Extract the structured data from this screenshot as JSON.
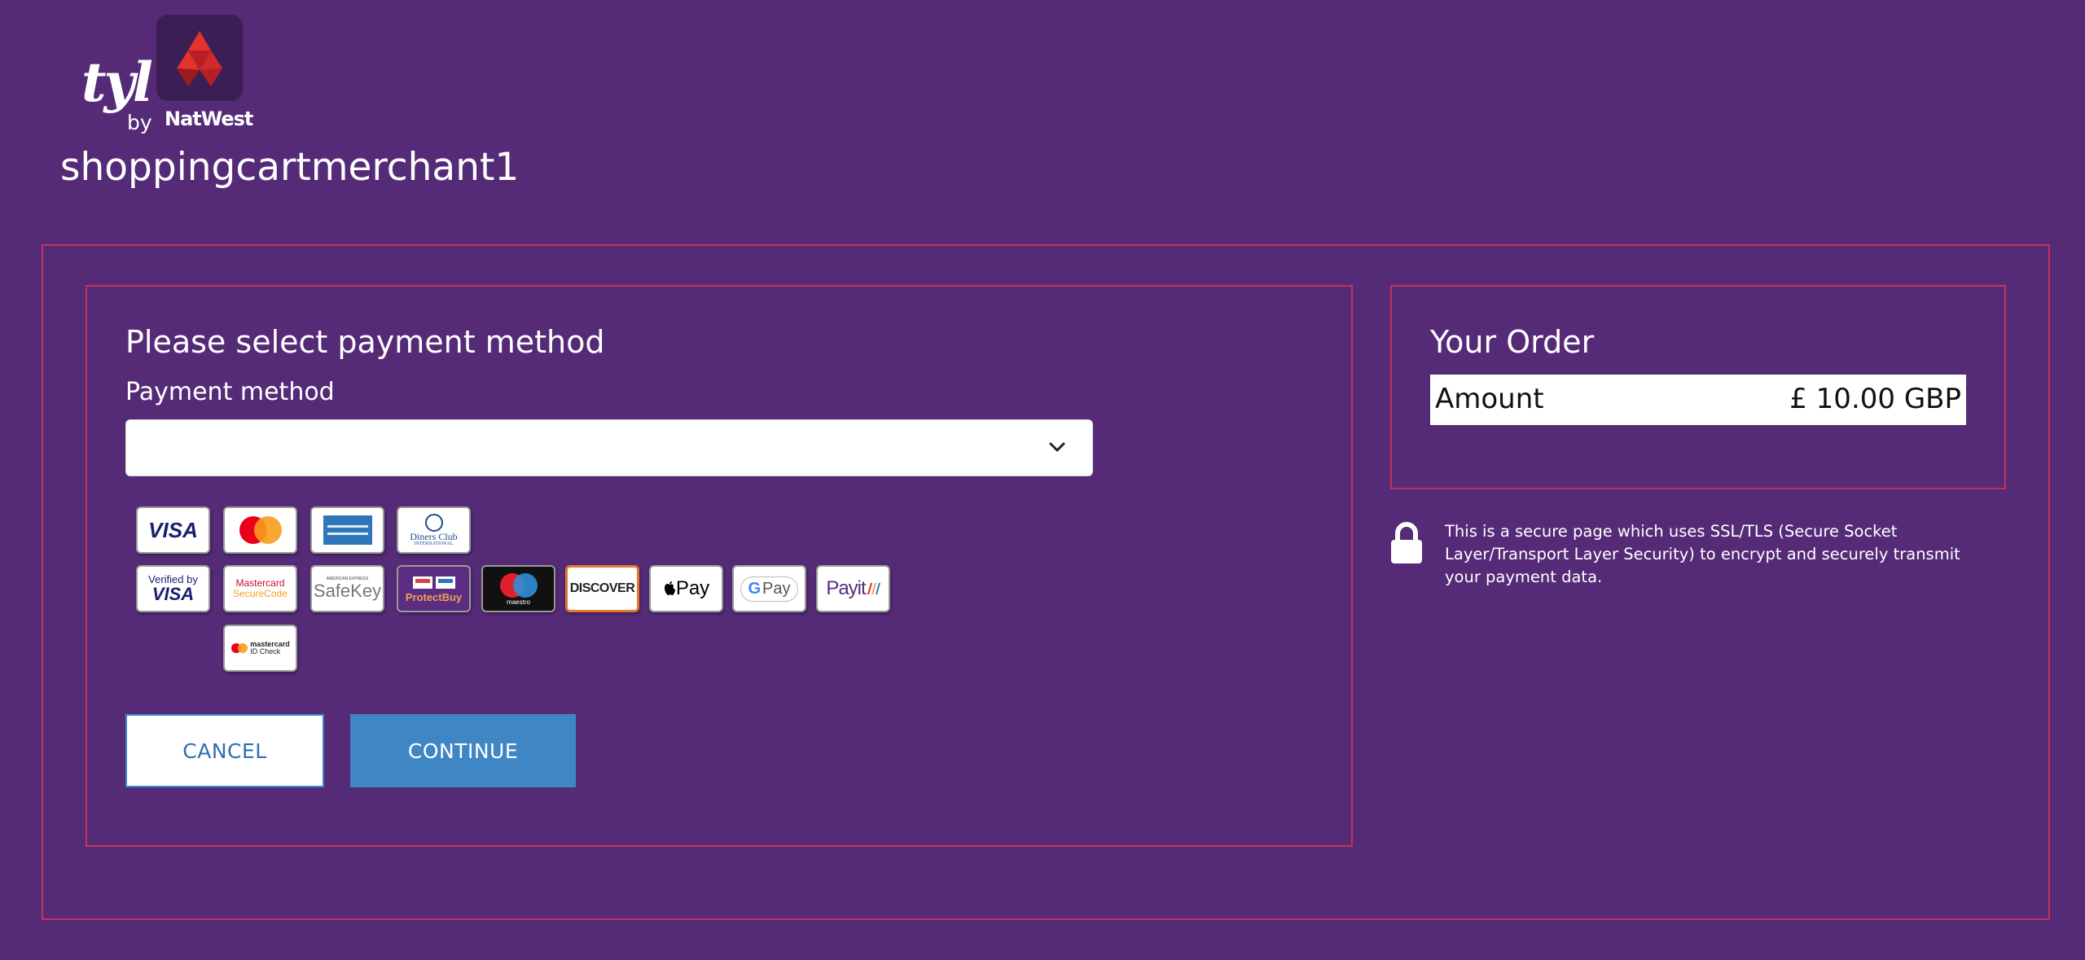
{
  "header": {
    "logo_word": "tyl",
    "logo_by": "by",
    "logo_brand": "NatWest",
    "merchant_name": "shoppingcartmerchant1"
  },
  "payment": {
    "heading": "Please select payment method",
    "label": "Payment method",
    "selected_value": "",
    "cards": {
      "visa": "VISA",
      "diners_line1": "Diners Club",
      "diners_line2": "INTERNATIONAL",
      "verified_by": "Verified by",
      "verified_visa": "VISA",
      "mc_secure_1": "Mastercard",
      "mc_secure_2": "SecureCode",
      "amex_small": "AMERICAN EXPRESS",
      "safekey": "SafeKey",
      "protectbuy": "ProtectBuy",
      "maestro": "maestro",
      "discover": "DISCOVER",
      "apple_pay": "Pay",
      "google_pay": "Pay",
      "payit": "Payit",
      "mc_idcheck_1": "mastercard",
      "mc_idcheck_2": "ID Check"
    }
  },
  "buttons": {
    "cancel": "CANCEL",
    "continue": "CONTINUE"
  },
  "order": {
    "title": "Your Order",
    "amount_label": "Amount",
    "amount_value": "£ 10.00 GBP"
  },
  "security": {
    "text": "This is a secure page which uses SSL/TLS (Secure Socket Layer/Transport Layer Security) to encrypt and securely transmit your payment data."
  },
  "colors": {
    "background": "#552a77",
    "frame": "#c4325a",
    "button_blue": "#3f86c5",
    "brand_red": "#d42b2b"
  },
  "icons": [
    "natwest-logo-icon",
    "chevron-down-icon",
    "lock-icon"
  ]
}
